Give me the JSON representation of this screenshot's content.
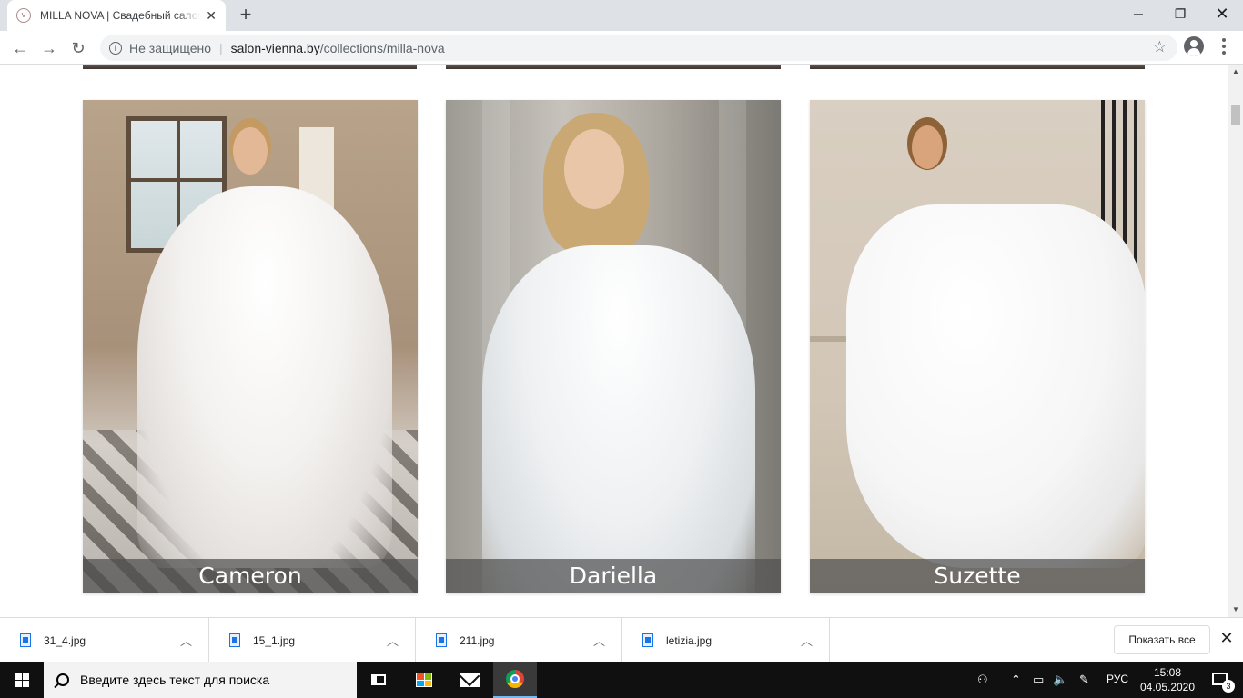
{
  "browser": {
    "tab_title": "MILLA NOVA | Свадебный салон",
    "new_tab_symbol": "+",
    "close_symbol": "✕",
    "security_label": "Не защищено",
    "url_host": "salon-vienna.by",
    "url_path": "/collections/milla-nova",
    "favicon_text": "VIENNA"
  },
  "gallery": {
    "cards": [
      {
        "name": "Cameron"
      },
      {
        "name": "Dariella"
      },
      {
        "name": "Suzette"
      }
    ]
  },
  "downloads": {
    "items": [
      {
        "file": "31_4.jpg"
      },
      {
        "file": "15_1.jpg"
      },
      {
        "file": "211.jpg"
      },
      {
        "file": "letizia.jpg"
      }
    ],
    "show_all_label": "Показать все"
  },
  "taskbar": {
    "search_placeholder": "Введите здесь текст для поиска",
    "language": "РУС",
    "time": "15:08",
    "date": "04.05.2020",
    "notification_count": "3"
  }
}
